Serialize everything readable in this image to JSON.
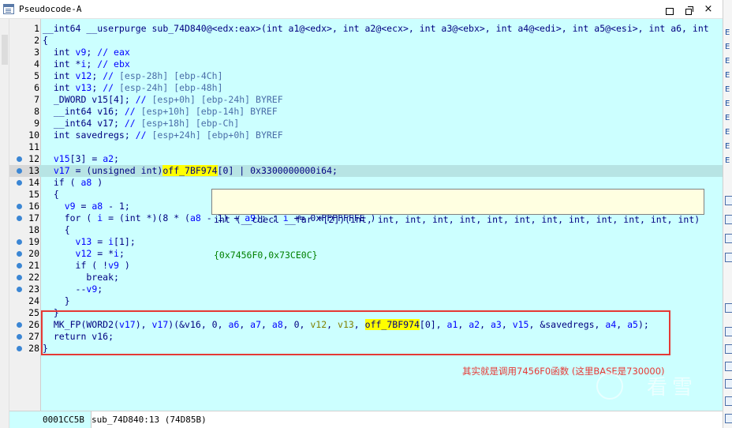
{
  "window": {
    "title": "Pseudocode-A",
    "buttons": {
      "minimize": "",
      "maximize": "",
      "close": "×"
    }
  },
  "code": {
    "lines": [
      {
        "n": "1",
        "bp": false,
        "parts": [
          [
            "kw",
            "__int64 __userpurge sub_74D840@<edx:eax>(int a1@<edx>, int a2@<ecx>, int a3@<ebx>, int a4@<edi>, int a5@<esi>, int a6, int"
          ]
        ]
      },
      {
        "n": "2",
        "bp": false,
        "parts": [
          [
            "kw",
            "{"
          ]
        ]
      },
      {
        "n": "3",
        "bp": false,
        "parts": [
          [
            "kw",
            "  int "
          ],
          [
            "var",
            "v9"
          ],
          [
            "kw",
            "; "
          ],
          [
            "cm",
            "// eax"
          ]
        ]
      },
      {
        "n": "4",
        "bp": false,
        "parts": [
          [
            "kw",
            "  int *"
          ],
          [
            "var",
            "i"
          ],
          [
            "kw",
            "; "
          ],
          [
            "cm",
            "// ebx"
          ]
        ]
      },
      {
        "n": "5",
        "bp": false,
        "parts": [
          [
            "kw",
            "  int "
          ],
          [
            "var",
            "v12"
          ],
          [
            "kw",
            "; "
          ],
          [
            "cm",
            "// "
          ],
          [
            "cmg",
            "[esp-28h] [ebp-4Ch]"
          ]
        ]
      },
      {
        "n": "6",
        "bp": false,
        "parts": [
          [
            "kw",
            "  int "
          ],
          [
            "var",
            "v13"
          ],
          [
            "kw",
            "; "
          ],
          [
            "cm",
            "// "
          ],
          [
            "cmg",
            "[esp-24h] [ebp-48h]"
          ]
        ]
      },
      {
        "n": "7",
        "bp": false,
        "parts": [
          [
            "kw",
            "  _DWORD v15[4]; "
          ],
          [
            "cm",
            "// "
          ],
          [
            "cmg",
            "[esp+0h] [ebp-24h] BYREF"
          ]
        ]
      },
      {
        "n": "8",
        "bp": false,
        "parts": [
          [
            "kw",
            "  __int64 v16; "
          ],
          [
            "cm",
            "// "
          ],
          [
            "cmg",
            "[esp+10h] [ebp-14h] BYREF"
          ]
        ]
      },
      {
        "n": "9",
        "bp": false,
        "parts": [
          [
            "kw",
            "  __int64 v17; "
          ],
          [
            "cm",
            "// "
          ],
          [
            "cmg",
            "[esp+18h] [ebp-Ch]"
          ]
        ]
      },
      {
        "n": "10",
        "bp": false,
        "parts": [
          [
            "kw",
            "  int savedregs; "
          ],
          [
            "cm",
            "// "
          ],
          [
            "cmg",
            "[esp+24h] [ebp+0h] BYREF"
          ]
        ]
      },
      {
        "n": "11",
        "bp": false,
        "parts": [
          [
            "kw",
            ""
          ]
        ]
      },
      {
        "n": "12",
        "bp": true,
        "parts": [
          [
            "kw",
            "  "
          ],
          [
            "var",
            "v15"
          ],
          [
            "kw",
            "[3] = "
          ],
          [
            "var",
            "a2"
          ],
          [
            "kw",
            ";"
          ]
        ]
      },
      {
        "n": "13",
        "bp": true,
        "current": true,
        "parts": [
          [
            "kw",
            "  "
          ],
          [
            "var",
            "v17"
          ],
          [
            "kw",
            " = (unsigned int)"
          ],
          [
            "hl",
            "off_7BF974"
          ],
          [
            "kw",
            "[0] | 0x3300000000i64;"
          ]
        ]
      },
      {
        "n": "14",
        "bp": true,
        "parts": [
          [
            "kw",
            "  if ( "
          ],
          [
            "var",
            "a8"
          ],
          [
            "kw",
            " )"
          ]
        ]
      },
      {
        "n": "15",
        "bp": false,
        "parts": [
          [
            "kw",
            "  {"
          ]
        ]
      },
      {
        "n": "16",
        "bp": true,
        "parts": [
          [
            "kw",
            "    "
          ],
          [
            "var",
            "v9"
          ],
          [
            "kw",
            " = "
          ],
          [
            "var",
            "a8"
          ],
          [
            "kw",
            " - 1;"
          ]
        ]
      },
      {
        "n": "17",
        "bp": true,
        "parts": [
          [
            "kw",
            "    for ( "
          ],
          [
            "var",
            "i"
          ],
          [
            "kw",
            " = (int *)(8 * ("
          ],
          [
            "var",
            "a8"
          ],
          [
            "kw",
            " - 1) + "
          ],
          [
            "var",
            "a9"
          ],
          [
            "kw",
            "); ; "
          ],
          [
            "var",
            "i"
          ],
          [
            "kw",
            " += 0xFFFFFFFE )"
          ]
        ]
      },
      {
        "n": "18",
        "bp": false,
        "parts": [
          [
            "kw",
            "    {"
          ]
        ]
      },
      {
        "n": "19",
        "bp": true,
        "parts": [
          [
            "kw",
            "      "
          ],
          [
            "var",
            "v13"
          ],
          [
            "kw",
            " = "
          ],
          [
            "var",
            "i"
          ],
          [
            "kw",
            "[1];"
          ]
        ]
      },
      {
        "n": "20",
        "bp": true,
        "parts": [
          [
            "kw",
            "      "
          ],
          [
            "var",
            "v12"
          ],
          [
            "kw",
            " = *"
          ],
          [
            "var",
            "i"
          ],
          [
            "kw",
            ";"
          ]
        ]
      },
      {
        "n": "21",
        "bp": true,
        "parts": [
          [
            "kw",
            "      if ( !"
          ],
          [
            "var",
            "v9"
          ],
          [
            "kw",
            " )"
          ]
        ]
      },
      {
        "n": "22",
        "bp": true,
        "parts": [
          [
            "kw",
            "        break;"
          ]
        ]
      },
      {
        "n": "23",
        "bp": true,
        "parts": [
          [
            "kw",
            "      --"
          ],
          [
            "var",
            "v9"
          ],
          [
            "kw",
            ";"
          ]
        ]
      },
      {
        "n": "24",
        "bp": false,
        "parts": [
          [
            "kw",
            "    }"
          ]
        ]
      },
      {
        "n": "25",
        "bp": false,
        "parts": [
          [
            "kw",
            "  }"
          ]
        ]
      },
      {
        "n": "26",
        "bp": true,
        "parts": [
          [
            "kw",
            "  MK_FP(WORD2("
          ],
          [
            "var",
            "v17"
          ],
          [
            "kw",
            "), "
          ],
          [
            "var",
            "v17"
          ],
          [
            "kw",
            ")(&v16, 0, "
          ],
          [
            "var",
            "a6"
          ],
          [
            "kw",
            ", "
          ],
          [
            "var",
            "a7"
          ],
          [
            "kw",
            ", "
          ],
          [
            "var",
            "a8"
          ],
          [
            "kw",
            ", 0, "
          ],
          [
            "gvar",
            "v12"
          ],
          [
            "kw",
            ", "
          ],
          [
            "gvar",
            "v13"
          ],
          [
            "kw",
            ", "
          ],
          [
            "hl",
            "off_7BF974"
          ],
          [
            "kw",
            "[0], "
          ],
          [
            "var",
            "a1"
          ],
          [
            "kw",
            ", "
          ],
          [
            "var",
            "a2"
          ],
          [
            "kw",
            ", "
          ],
          [
            "var",
            "a3"
          ],
          [
            "kw",
            ", "
          ],
          [
            "var",
            "v15"
          ],
          [
            "kw",
            ", &savedregs, "
          ],
          [
            "var",
            "a4"
          ],
          [
            "kw",
            ", "
          ],
          [
            "var",
            "a5"
          ],
          [
            "kw",
            ");"
          ]
        ]
      },
      {
        "n": "27",
        "bp": true,
        "parts": [
          [
            "kw",
            "  return v16;"
          ]
        ]
      },
      {
        "n": "28",
        "bp": true,
        "parts": [
          [
            "kw",
            "}"
          ]
        ]
      }
    ]
  },
  "tooltip": {
    "line1": "int (__cdecl __far *[2])(int, int, int, int, int, int, int, int, int, int, int, int, int)",
    "line2": "{0x7456F0,0x73CE0C}"
  },
  "annotation": {
    "text": "其实就是调用7456F0函数 (这里BASE是730000)"
  },
  "watermark": {
    "text": "看雪"
  },
  "status": {
    "address": "0001CC5B",
    "location": "sub_74D840:13 (74D85B)"
  },
  "right_panel": {
    "items": [
      "E",
      "E",
      "E",
      "E",
      "E",
      "E",
      "E",
      "E",
      "E",
      "E"
    ]
  },
  "colors": {
    "code_bg": "#ccffff",
    "highlight": "#ffff00",
    "annotation": "#e53935",
    "keyword": "#000080",
    "variable": "#0000ff"
  }
}
